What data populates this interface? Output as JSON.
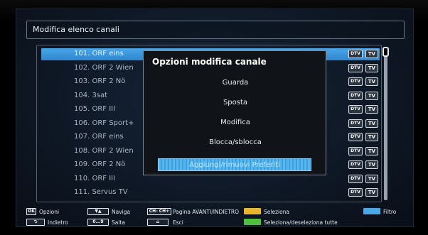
{
  "header": {
    "title": "Modifica elenco canali"
  },
  "channels": [
    {
      "label": "101. ORF eins",
      "selected": true
    },
    {
      "label": "102. ORF 2 Wien",
      "selected": false
    },
    {
      "label": "103. ORF 2 Nö",
      "selected": false
    },
    {
      "label": "104. 3sat",
      "selected": false
    },
    {
      "label": "105. ORF III",
      "selected": false
    },
    {
      "label": "106. ORF Sport+",
      "selected": false
    },
    {
      "label": "107. ORF eins",
      "selected": false
    },
    {
      "label": "108. ORF 2 Wien",
      "selected": false
    },
    {
      "label": "109. ORF 2 Nö",
      "selected": false
    },
    {
      "label": "110. ORF III",
      "selected": false
    },
    {
      "label": "111. Servus TV",
      "selected": false
    }
  ],
  "badges": {
    "dtv": "DTV",
    "tv": "TV"
  },
  "popup": {
    "title": "Opzioni modifica canale",
    "items": [
      {
        "label": "Guarda"
      },
      {
        "label": "Sposta"
      },
      {
        "label": "Modifica"
      },
      {
        "label": "Blocca/sblocca"
      },
      {
        "label": "Aggiungi/rimuovi Preferiti"
      }
    ],
    "active_index": 4
  },
  "footer": {
    "ok_key": "OK",
    "options_label": "Opzioni",
    "back_label": "Indietro",
    "navigate_label": "Naviga",
    "skip_key": "0...9",
    "skip_label": "Salta",
    "page_keys": "CH- CH+",
    "page_label": "Pagina AVANTI/INDIETRO",
    "exit_label": "Esci",
    "select_label": "Seleziona",
    "select_all_label": "Seleziona/deseleziona tutte",
    "filter_label": "Filtro"
  },
  "colors": {
    "selection": "#3a93db",
    "yellow_key": "#e8b628",
    "green_key": "#4fbf3c",
    "blue_key": "#4aa8e6"
  }
}
